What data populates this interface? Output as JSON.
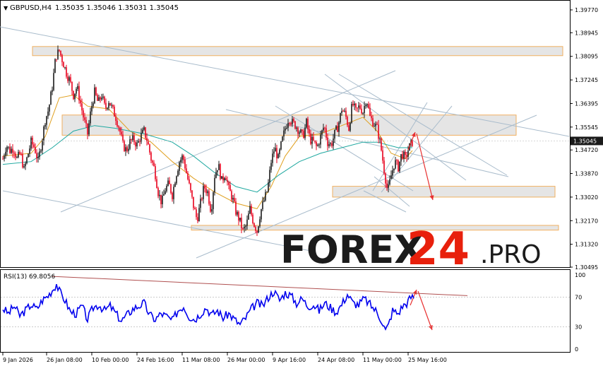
{
  "header": {
    "symbol_label": "GBPUSD,H4",
    "ohlc_values": "1.35035 1.35046 1.35031 1.35045"
  },
  "watermark": {
    "brand_main": "FOREX",
    "brand_num": "24",
    "brand_suffix": ".PRO"
  },
  "rsi_panel": {
    "label": "RSI(13) 69.8056"
  },
  "colors": {
    "bull": "#1a1a1a",
    "bear": "#e8001c",
    "ma_fast": "#e0a020",
    "ma_slow": "#1fa8a0",
    "rsi_line": "#0000ee",
    "zone_fill": "#e0e0e0",
    "zone_border": "#f0b060",
    "trendline": "#a9bccc",
    "arrow": "#e83030",
    "rsi_trend": "#b05050",
    "price_tag_bg": "#1a1a1a"
  },
  "chart_data": [
    {
      "type": "candlestick",
      "name": "",
      "price_axis_labels": [
        "1.39770",
        "1.38945",
        "1.38095",
        "1.37245",
        "1.36395",
        "1.35545",
        "1.34720",
        "1.33870",
        "1.33020",
        "1.32170",
        "1.31320",
        "1.30495"
      ],
      "price_axis_values": [
        1.3977,
        1.38945,
        1.38095,
        1.37245,
        1.36395,
        1.35545,
        1.3472,
        1.3387,
        1.3302,
        1.3217,
        1.3132,
        1.30495
      ],
      "current_price_label": "1.35045",
      "current_price": 1.35045,
      "time_labels": [
        "9 Jan 2026",
        "26 Jan 08:00",
        "10 Feb 00:00",
        "24 Feb 16:00",
        "11 Mar 08:00",
        "26 Mar 00:00",
        "9 Apr 16:00",
        "24 Apr 08:00",
        "11 May 00:00",
        "25 May 16:00"
      ],
      "ylim": [
        1.3025,
        1.3995
      ],
      "price_path": [
        [
          0,
          1.344
        ],
        [
          5,
          1.349
        ],
        [
          10,
          1.347
        ],
        [
          15,
          1.348
        ],
        [
          20,
          1.344
        ],
        [
          25,
          1.346
        ],
        [
          30,
          1.34
        ],
        [
          35,
          1.345
        ],
        [
          40,
          1.35
        ],
        [
          45,
          1.348
        ],
        [
          50,
          1.343
        ],
        [
          55,
          1.35
        ],
        [
          60,
          1.358
        ],
        [
          65,
          1.362
        ],
        [
          70,
          1.37
        ],
        [
          75,
          1.381
        ],
        [
          80,
          1.383
        ],
        [
          85,
          1.379
        ],
        [
          90,
          1.375
        ],
        [
          95,
          1.372
        ],
        [
          100,
          1.367
        ],
        [
          105,
          1.37
        ],
        [
          110,
          1.364
        ],
        [
          115,
          1.358
        ],
        [
          120,
          1.353
        ],
        [
          125,
          1.362
        ],
        [
          130,
          1.368
        ],
        [
          135,
          1.364
        ],
        [
          140,
          1.367
        ],
        [
          145,
          1.362
        ],
        [
          150,
          1.365
        ],
        [
          155,
          1.362
        ],
        [
          160,
          1.359
        ],
        [
          165,
          1.355
        ],
        [
          170,
          1.349
        ],
        [
          175,
          1.347
        ],
        [
          180,
          1.35
        ],
        [
          185,
          1.351
        ],
        [
          190,
          1.349
        ],
        [
          195,
          1.352
        ],
        [
          200,
          1.354
        ],
        [
          205,
          1.35
        ],
        [
          210,
          1.344
        ],
        [
          215,
          1.34
        ],
        [
          220,
          1.332
        ],
        [
          225,
          1.328
        ],
        [
          230,
          1.333
        ],
        [
          235,
          1.335
        ],
        [
          240,
          1.331
        ],
        [
          245,
          1.338
        ],
        [
          250,
          1.343
        ],
        [
          255,
          1.345
        ],
        [
          260,
          1.339
        ],
        [
          265,
          1.333
        ],
        [
          270,
          1.327
        ],
        [
          275,
          1.322
        ],
        [
          280,
          1.328
        ],
        [
          285,
          1.334
        ],
        [
          290,
          1.332
        ],
        [
          295,
          1.325
        ],
        [
          300,
          1.338
        ],
        [
          305,
          1.342
        ],
        [
          310,
          1.336
        ],
        [
          315,
          1.339
        ],
        [
          320,
          1.333
        ],
        [
          325,
          1.33
        ],
        [
          330,
          1.325
        ],
        [
          335,
          1.322
        ],
        [
          340,
          1.318
        ],
        [
          345,
          1.32
        ],
        [
          350,
          1.326
        ],
        [
          355,
          1.321
        ],
        [
          360,
          1.318
        ],
        [
          365,
          1.325
        ],
        [
          370,
          1.329
        ],
        [
          375,
          1.333
        ],
        [
          380,
          1.343
        ],
        [
          385,
          1.348
        ],
        [
          390,
          1.344
        ],
        [
          395,
          1.35
        ],
        [
          400,
          1.355
        ],
        [
          405,
          1.359
        ],
        [
          410,
          1.357
        ],
        [
          415,
          1.356
        ],
        [
          420,
          1.354
        ],
        [
          425,
          1.352
        ],
        [
          430,
          1.357
        ],
        [
          435,
          1.351
        ],
        [
          440,
          1.35
        ],
        [
          445,
          1.348
        ],
        [
          450,
          1.352
        ],
        [
          455,
          1.356
        ],
        [
          460,
          1.35
        ],
        [
          465,
          1.349
        ],
        [
          470,
          1.353
        ],
        [
          475,
          1.356
        ],
        [
          480,
          1.362
        ],
        [
          485,
          1.36
        ],
        [
          490,
          1.355
        ],
        [
          495,
          1.364
        ],
        [
          500,
          1.361
        ],
        [
          505,
          1.363
        ],
        [
          510,
          1.361
        ],
        [
          515,
          1.366
        ],
        [
          520,
          1.359
        ],
        [
          525,
          1.357
        ],
        [
          530,
          1.355
        ],
        [
          535,
          1.349
        ],
        [
          540,
          1.34
        ],
        [
          545,
          1.332
        ],
        [
          550,
          1.338
        ],
        [
          555,
          1.343
        ],
        [
          560,
          1.341
        ],
        [
          565,
          1.346
        ],
        [
          570,
          1.344
        ],
        [
          575,
          1.348
        ],
        [
          580,
          1.35
        ]
      ],
      "ma_fast": [
        [
          0,
          1.345
        ],
        [
          40,
          1.346
        ],
        [
          60,
          1.352
        ],
        [
          80,
          1.366
        ],
        [
          100,
          1.367
        ],
        [
          120,
          1.363
        ],
        [
          150,
          1.362
        ],
        [
          180,
          1.354
        ],
        [
          210,
          1.35
        ],
        [
          240,
          1.343
        ],
        [
          270,
          1.337
        ],
        [
          300,
          1.332
        ],
        [
          330,
          1.328
        ],
        [
          360,
          1.326
        ],
        [
          380,
          1.334
        ],
        [
          400,
          1.345
        ],
        [
          420,
          1.352
        ],
        [
          450,
          1.353
        ],
        [
          480,
          1.356
        ],
        [
          510,
          1.359
        ],
        [
          530,
          1.354
        ],
        [
          550,
          1.346
        ],
        [
          570,
          1.344
        ],
        [
          580,
          1.347
        ]
      ],
      "ma_slow": [
        [
          0,
          1.342
        ],
        [
          40,
          1.343
        ],
        [
          70,
          1.348
        ],
        [
          100,
          1.354
        ],
        [
          130,
          1.356
        ],
        [
          160,
          1.355
        ],
        [
          200,
          1.353
        ],
        [
          240,
          1.35
        ],
        [
          270,
          1.345
        ],
        [
          300,
          1.339
        ],
        [
          330,
          1.334
        ],
        [
          360,
          1.332
        ],
        [
          390,
          1.338
        ],
        [
          420,
          1.343
        ],
        [
          450,
          1.346
        ],
        [
          480,
          1.348
        ],
        [
          510,
          1.35
        ],
        [
          530,
          1.35
        ],
        [
          560,
          1.348
        ],
        [
          580,
          1.348
        ]
      ],
      "zones": [
        {
          "x0": 46,
          "x1": 797,
          "top": 1.3845,
          "bottom": 1.3812
        },
        {
          "x0": 88,
          "x1": 731,
          "top": 1.3598,
          "bottom": 1.3525
        },
        {
          "x0": 471,
          "x1": 786,
          "top": 1.3341,
          "bottom": 1.3302
        },
        {
          "x0": 271,
          "x1": 791,
          "top": 1.32,
          "bottom": 1.3183
        }
      ]
    },
    {
      "type": "line",
      "name": "RSI(13)",
      "y_axis_labels": [
        "100",
        "70",
        "30",
        "0"
      ],
      "y_axis_values": [
        100,
        70,
        30,
        0
      ],
      "ylim": [
        0,
        100
      ],
      "values": [
        [
          0,
          55
        ],
        [
          8,
          48
        ],
        [
          16,
          58
        ],
        [
          24,
          45
        ],
        [
          32,
          52
        ],
        [
          40,
          60
        ],
        [
          48,
          54
        ],
        [
          56,
          66
        ],
        [
          64,
          72
        ],
        [
          72,
          82
        ],
        [
          76,
          88
        ],
        [
          80,
          78
        ],
        [
          88,
          66
        ],
        [
          96,
          50
        ],
        [
          104,
          48
        ],
        [
          112,
          58
        ],
        [
          120,
          40
        ],
        [
          128,
          56
        ],
        [
          136,
          60
        ],
        [
          144,
          52
        ],
        [
          152,
          58
        ],
        [
          160,
          48
        ],
        [
          168,
          38
        ],
        [
          176,
          46
        ],
        [
          184,
          54
        ],
        [
          192,
          58
        ],
        [
          200,
          62
        ],
        [
          208,
          46
        ],
        [
          216,
          40
        ],
        [
          224,
          48
        ],
        [
          232,
          44
        ],
        [
          240,
          38
        ],
        [
          248,
          52
        ],
        [
          256,
          58
        ],
        [
          264,
          44
        ],
        [
          272,
          40
        ],
        [
          280,
          48
        ],
        [
          288,
          56
        ],
        [
          296,
          46
        ],
        [
          304,
          52
        ],
        [
          312,
          42
        ],
        [
          320,
          48
        ],
        [
          328,
          40
        ],
        [
          336,
          33
        ],
        [
          344,
          42
        ],
        [
          352,
          54
        ],
        [
          360,
          62
        ],
        [
          368,
          58
        ],
        [
          376,
          70
        ],
        [
          384,
          78
        ],
        [
          392,
          66
        ],
        [
          400,
          76
        ],
        [
          408,
          72
        ],
        [
          416,
          62
        ],
        [
          424,
          68
        ],
        [
          432,
          58
        ],
        [
          440,
          60
        ],
        [
          448,
          52
        ],
        [
          456,
          62
        ],
        [
          464,
          56
        ],
        [
          472,
          50
        ],
        [
          480,
          60
        ],
        [
          488,
          74
        ],
        [
          496,
          62
        ],
        [
          504,
          60
        ],
        [
          512,
          68
        ],
        [
          520,
          60
        ],
        [
          528,
          52
        ],
        [
          536,
          40
        ],
        [
          542,
          25
        ],
        [
          546,
          32
        ],
        [
          552,
          52
        ],
        [
          560,
          48
        ],
        [
          566,
          58
        ],
        [
          572,
          62
        ],
        [
          578,
          70
        ],
        [
          582,
          70
        ]
      ]
    }
  ]
}
